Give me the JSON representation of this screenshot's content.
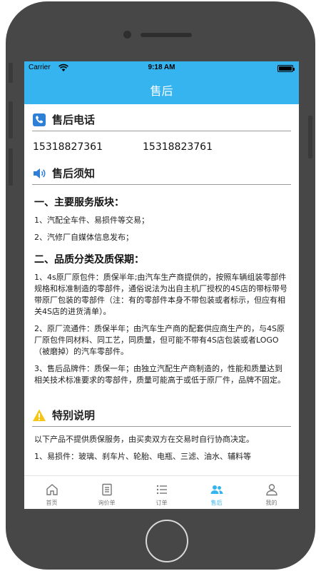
{
  "status": {
    "carrier": "Carrier",
    "time": "9:18 AM"
  },
  "nav": {
    "title": "售后"
  },
  "phone_section": {
    "title": "售后电话",
    "numbers": [
      "15318827361",
      "15318823761"
    ]
  },
  "notice_section": {
    "title": "售后须知",
    "h1": "一、主要服务版块：",
    "s1_items": [
      "1、汽配全车件、易损件等交易；",
      "2、汽修厂自媒体信息发布；"
    ],
    "h2": "二、品质分类及质保期：",
    "para1": "1、4s原厂原包件：质保半年;由汽车生产商提供的，按照车辆组装零部件规格和标准制造的零部件，通俗说法为出自主机厂授权的4S店的带标带号带原厂包装的零部件（注：有的零部件本身不带包装或者标示，但应有相关4S店的进货清单）。",
    "para2": "2、原厂流通件：质保半年；由汽车生产商的配套供应商生产的，与4S原厂原包件同材料、同工艺，同质量，但可能不带有4S店包装或者LOGO（被磨掉）的汽车零部件。",
    "para3": "3、售后品牌件：质保一年；由独立汽配生产商制造的，性能和质量达到相关技术标准要求的零部件，质量可能高于或低于原厂件，品牌不固定。"
  },
  "special_section": {
    "title": "特别说明",
    "para1": "以下产品不提供质保服务，由买卖双方在交易时自行协商决定。",
    "para2": "1、易损件：玻璃、刹车片、轮胎、电瓶、三滤、油水、辅料等"
  },
  "tabs": [
    {
      "label": "首页",
      "icon": "home-icon"
    },
    {
      "label": "询价单",
      "icon": "document-icon"
    },
    {
      "label": "订单",
      "icon": "list-icon"
    },
    {
      "label": "售后",
      "icon": "people-icon",
      "active": true
    },
    {
      "label": "我的",
      "icon": "person-icon"
    }
  ],
  "colors": {
    "accent": "#35b4ef",
    "phone_icon": "#2e7fd6",
    "warning_icon": "#f5c518",
    "device": "#474747"
  }
}
